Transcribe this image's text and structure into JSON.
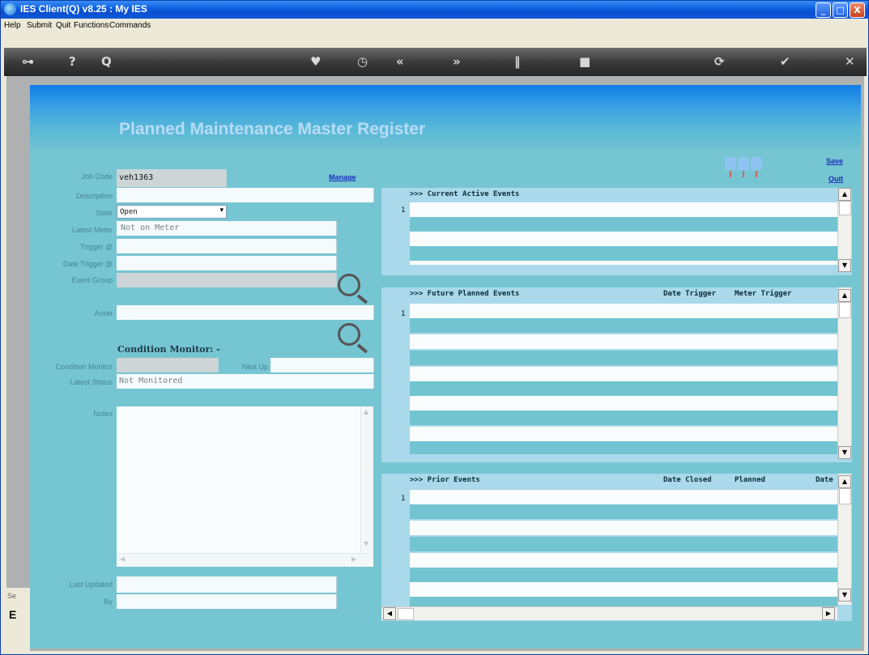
{
  "window": {
    "title": "IES Client(Q) v8.25 : My IES",
    "min": "_",
    "max": "□",
    "close": "X"
  },
  "menu": [
    "Help",
    "Submit",
    "Quit",
    "Functions",
    "Commands"
  ],
  "toolbar_icons": [
    "key-icon",
    "help-icon",
    "search-icon",
    "heart-icon",
    "clock-icon",
    "rewind-icon",
    "forward-icon",
    "pause-icon",
    "stop-icon",
    "refresh-icon",
    "check-icon",
    "close-icon"
  ],
  "page": {
    "heading": "Planned Maintenance Master Register",
    "save": "Save",
    "quit": "Quit",
    "manage": "Manage"
  },
  "form": {
    "job_code_label": "Job Code",
    "job_code": "veh1363",
    "description_label": "Description",
    "state_label": "State",
    "state": "Open",
    "latest_meter_label": "Latest Meter",
    "latest_meter": "Not on Meter",
    "trigger_label": "Trigger @",
    "date_trigger_label": "Date Trigger @",
    "event_group_label": "Event Group",
    "asset_label": "Asset",
    "condition_heading": "Condition Monitor: -",
    "condition_monitor_label": "Condition Monitor",
    "next_up_label": "Next Up",
    "latest_status_label": "Latest Status",
    "latest_status": "Not Monitored",
    "notes_label": "Notes",
    "last_updated_label": "Last Updated",
    "by_label": "By"
  },
  "grids": {
    "current": {
      "header": ">>> Current Active Events",
      "row1": "1"
    },
    "future": {
      "header": ">>> Future Planned Events",
      "col2": "Date Trigger",
      "col3": "Meter Trigger",
      "row1": "1"
    },
    "prior": {
      "header": ">>> Prior Events",
      "col2": "Date Closed",
      "col3": "Planned",
      "col4": "Date",
      "row1": "1"
    }
  },
  "side_peek": {
    "text1": "Se",
    "text2": "E"
  },
  "colors": {
    "panel": "#76c5d2",
    "banner": "#0f7de6",
    "grid_header": "#a9d9ea",
    "link": "#1a2fbd"
  }
}
